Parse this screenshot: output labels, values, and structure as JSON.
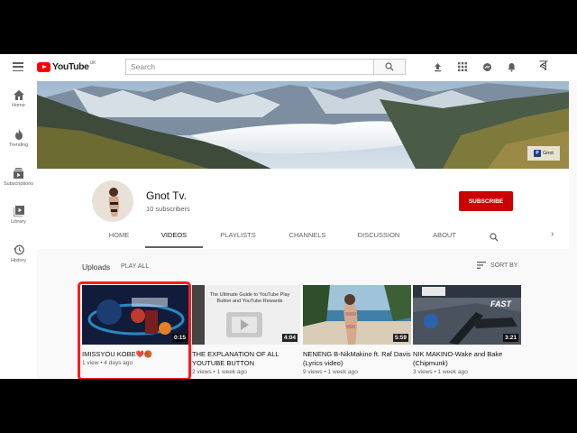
{
  "topbar": {
    "logo_text": "YouTube",
    "logo_region": "UK",
    "search_placeholder": "Search",
    "avatar_glyph": "ৰ",
    "icons": [
      "menu-icon",
      "search-icon",
      "upload-icon",
      "apps-icon",
      "messages-icon",
      "notifications-icon"
    ]
  },
  "sidebar": {
    "items": [
      {
        "label": "Home",
        "icon": "home-icon"
      },
      {
        "label": "Trending",
        "icon": "flame-icon"
      },
      {
        "label": "Subscriptions",
        "icon": "subscriptions-icon"
      },
      {
        "label": "Library",
        "icon": "library-icon"
      },
      {
        "label": "History",
        "icon": "history-icon"
      }
    ]
  },
  "banner": {
    "badge_text": "Gnot"
  },
  "channel": {
    "name": "Gnot Tv.",
    "subscribers": "10 subscribers",
    "subscribe_label": "SUBSCRIBE"
  },
  "tabs": [
    {
      "label": "HOME",
      "active": false
    },
    {
      "label": "VIDEOS",
      "active": true
    },
    {
      "label": "PLAYLISTS",
      "active": false
    },
    {
      "label": "CHANNELS",
      "active": false
    },
    {
      "label": "DISCUSSION",
      "active": false
    },
    {
      "label": "ABOUT",
      "active": false
    }
  ],
  "uploads": {
    "title": "Uploads",
    "play_all": "PLAY ALL",
    "sort_label": "SORT BY"
  },
  "videos": [
    {
      "title": "IMISSYOU KOBE❤️🏀",
      "meta": "1 view • 4 days ago",
      "duration": "0:15"
    },
    {
      "title": "THE EXPLANATION OF ALL YOUTUBE BUTTON",
      "meta": "2 views • 1 week ago",
      "duration": "4:04",
      "thumb_text": "The Ultimate Guide to YouTube Play Button and YouTube Rewards"
    },
    {
      "title": "NENENG B-NikMakino ft. Raf Davis (Lyrics video)",
      "meta": "9 views • 1 week ago",
      "duration": "5:59"
    },
    {
      "title": "NIK MAKINO-Wake and Bake (Chipmunk)",
      "meta": "3 views • 1 week ago",
      "duration": "3:21",
      "thumb_text": "FAST"
    }
  ],
  "colors": {
    "brand_red": "#ff0000",
    "subscribe_red": "#cc0000",
    "highlight_red": "#ff1a1a"
  }
}
